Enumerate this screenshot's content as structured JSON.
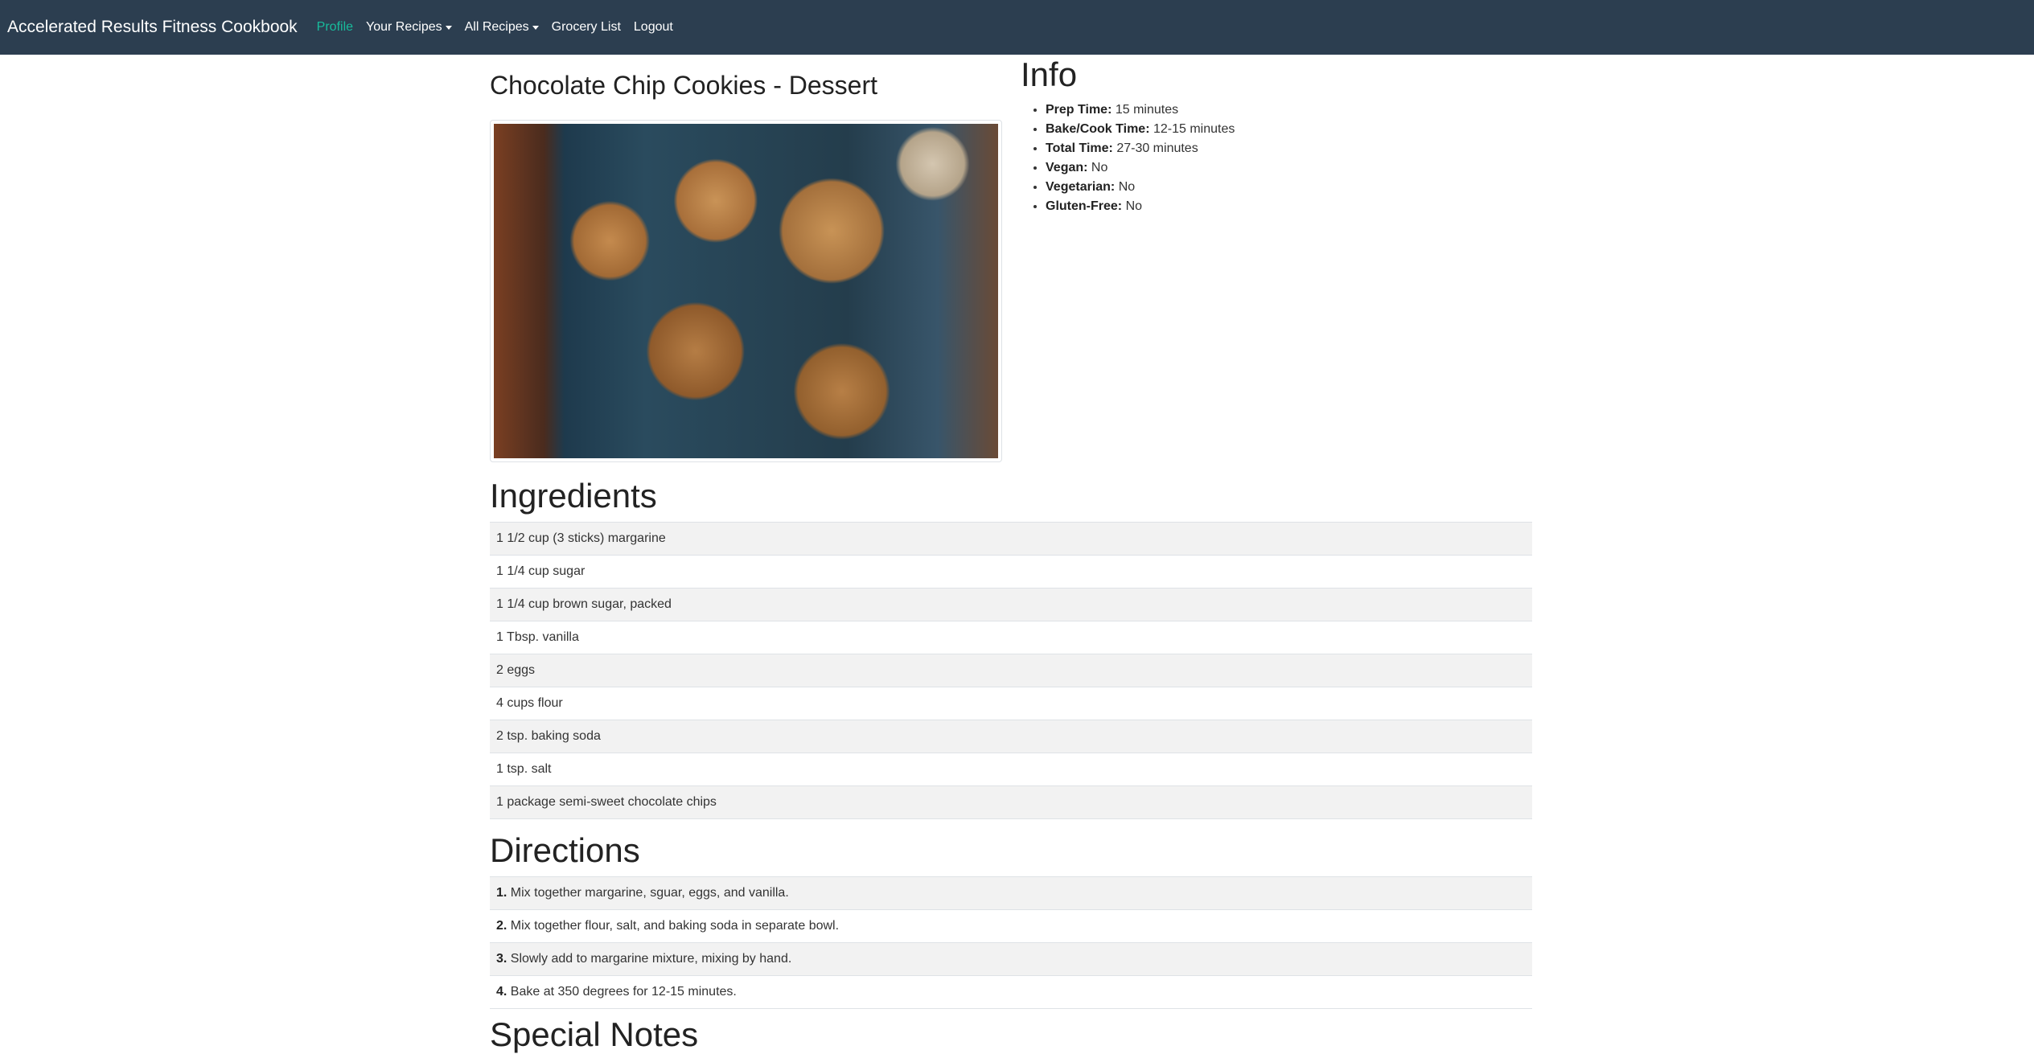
{
  "navbar": {
    "brand": "Accelerated Results Fitness Cookbook",
    "links": [
      {
        "label": "Profile",
        "active": true,
        "dropdown": false
      },
      {
        "label": "Your Recipes",
        "active": false,
        "dropdown": true
      },
      {
        "label": "All Recipes",
        "active": false,
        "dropdown": true
      },
      {
        "label": "Grocery List",
        "active": false,
        "dropdown": false
      },
      {
        "label": "Logout",
        "active": false,
        "dropdown": false
      }
    ]
  },
  "recipe": {
    "title": "Chocolate Chip Cookies - Dessert",
    "image_alt": "chocolate chip cookies photo"
  },
  "info": {
    "heading": "Info",
    "items": [
      {
        "label": "Prep Time:",
        "value": "15 minutes"
      },
      {
        "label": "Bake/Cook Time:",
        "value": "12-15 minutes"
      },
      {
        "label": "Total Time:",
        "value": "27-30 minutes"
      },
      {
        "label": "Vegan:",
        "value": "No"
      },
      {
        "label": "Vegetarian:",
        "value": "No"
      },
      {
        "label": "Gluten-Free:",
        "value": "No"
      }
    ]
  },
  "ingredients": {
    "heading": "Ingredients",
    "items": [
      "1 1/2 cup (3 sticks) margarine",
      "1 1/4 cup sugar",
      "1 1/4 cup brown sugar, packed",
      "1 Tbsp. vanilla",
      "2 eggs",
      "4 cups flour",
      "2 tsp. baking soda",
      "1 tsp. salt",
      "1 package semi-sweet chocolate chips"
    ]
  },
  "directions": {
    "heading": "Directions",
    "steps": [
      {
        "num": "1.",
        "text": "Mix together margarine, sguar, eggs, and vanilla."
      },
      {
        "num": "2.",
        "text": "Mix together flour, salt, and baking soda in separate bowl."
      },
      {
        "num": "3.",
        "text": "Slowly add to margarine mixture, mixing by hand."
      },
      {
        "num": "4.",
        "text": "Bake at 350 degrees for 12-15 minutes."
      }
    ]
  },
  "notes": {
    "heading": "Special Notes"
  },
  "colors": {
    "navbar_bg": "#2c3e50",
    "active_link": "#18bc9c",
    "striped_row": "#f2f2f2"
  }
}
